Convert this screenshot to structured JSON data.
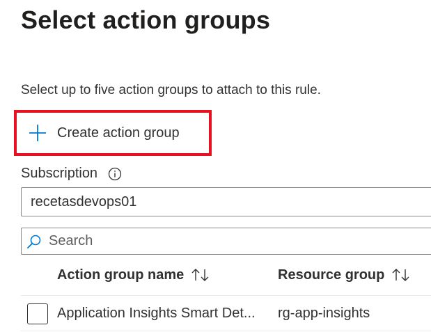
{
  "panel": {
    "title": "Select action groups",
    "description": "Select up to five action groups to attach to this rule."
  },
  "create_button": {
    "label": "Create action group",
    "icon": "plus-icon"
  },
  "subscription": {
    "label": "Subscription",
    "info_icon": "info-icon",
    "value": "recetasdevops01"
  },
  "search": {
    "placeholder": "Search",
    "icon": "search-icon"
  },
  "table": {
    "columns": [
      {
        "label": "Action group name",
        "sort_icon": "sort-icon"
      },
      {
        "label": "Resource group",
        "sort_icon": "sort-icon"
      }
    ],
    "rows": [
      {
        "name": "Application Insights Smart Det...",
        "resource_group": "rg-app-insights",
        "checked": false
      }
    ]
  },
  "colors": {
    "accent": "#0078d4",
    "highlight_border": "#e81123",
    "text": "#323130"
  }
}
